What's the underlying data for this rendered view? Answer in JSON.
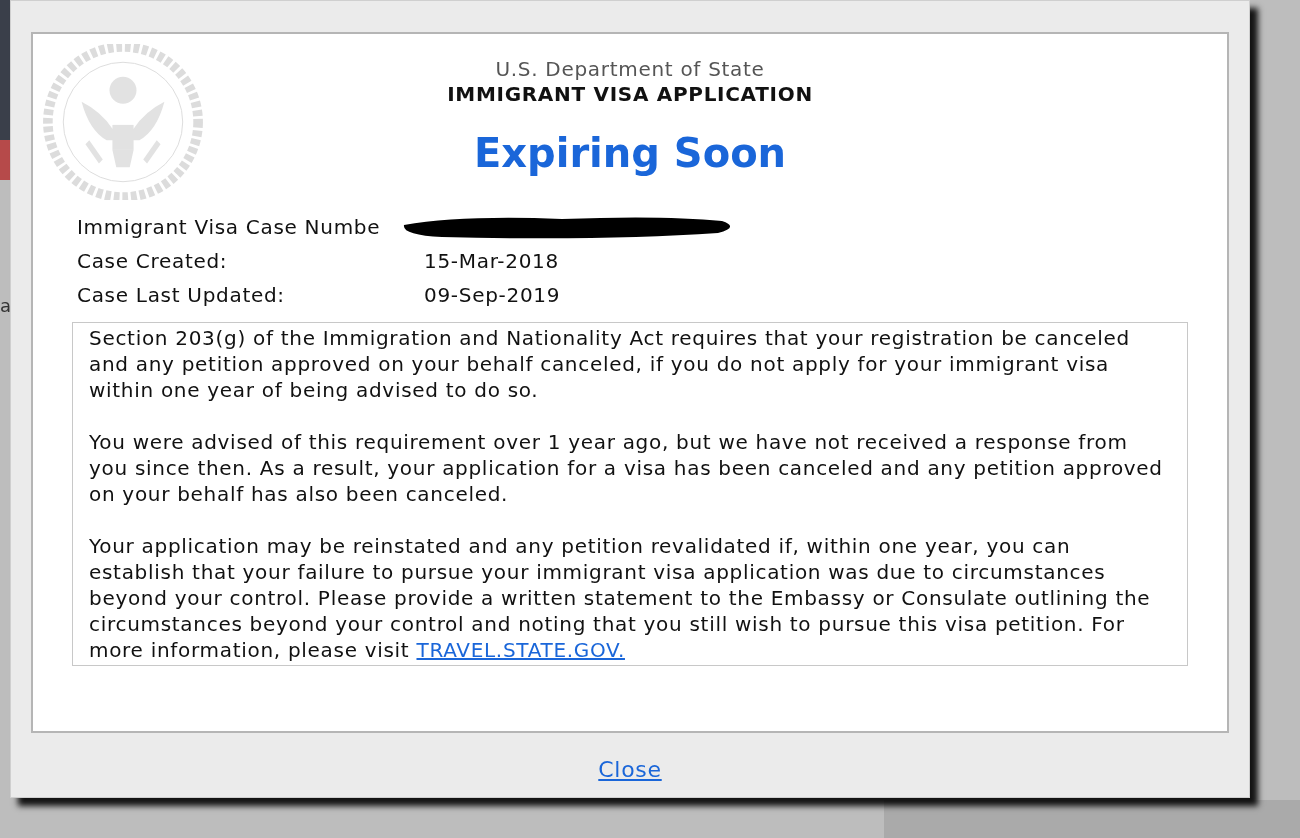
{
  "background": {
    "fragment": "a"
  },
  "dialog": {
    "agency": "U.S. Department of State",
    "title": "IMMIGRANT VISA APPLICATION",
    "status": "Expiring Soon",
    "fields": [
      {
        "label": "Immigrant Visa Case Numbe",
        "redacted": true
      },
      {
        "label": "Case Created:",
        "value": "15-Mar-2018",
        "redacted": false
      },
      {
        "label": "Case Last Updated:",
        "value": "09-Sep-2019",
        "redacted": false
      }
    ],
    "paragraphs": [
      "Section 203(g) of the Immigration and Nationality Act requires that your registration be canceled and any petition approved on your behalf canceled, if you do not apply for your immigrant visa within one year of being advised to do so.",
      "You were advised of this requirement over 1 year ago, but we have not received a response from you since then. As a result, your application for a visa has been canceled and any petition approved on your behalf has also been canceled.",
      "Your application may be reinstated and any petition revalidated if, within one year, you can establish that your failure to pursue your immigrant visa application was due to circumstances beyond your control. Please provide a written statement to the Embassy or Consulate outlining the circumstances beyond your control and noting that you still wish to pursue this visa petition. For more information, please visit"
    ],
    "link": "TRAVEL.STATE.GOV.",
    "close": "Close"
  }
}
